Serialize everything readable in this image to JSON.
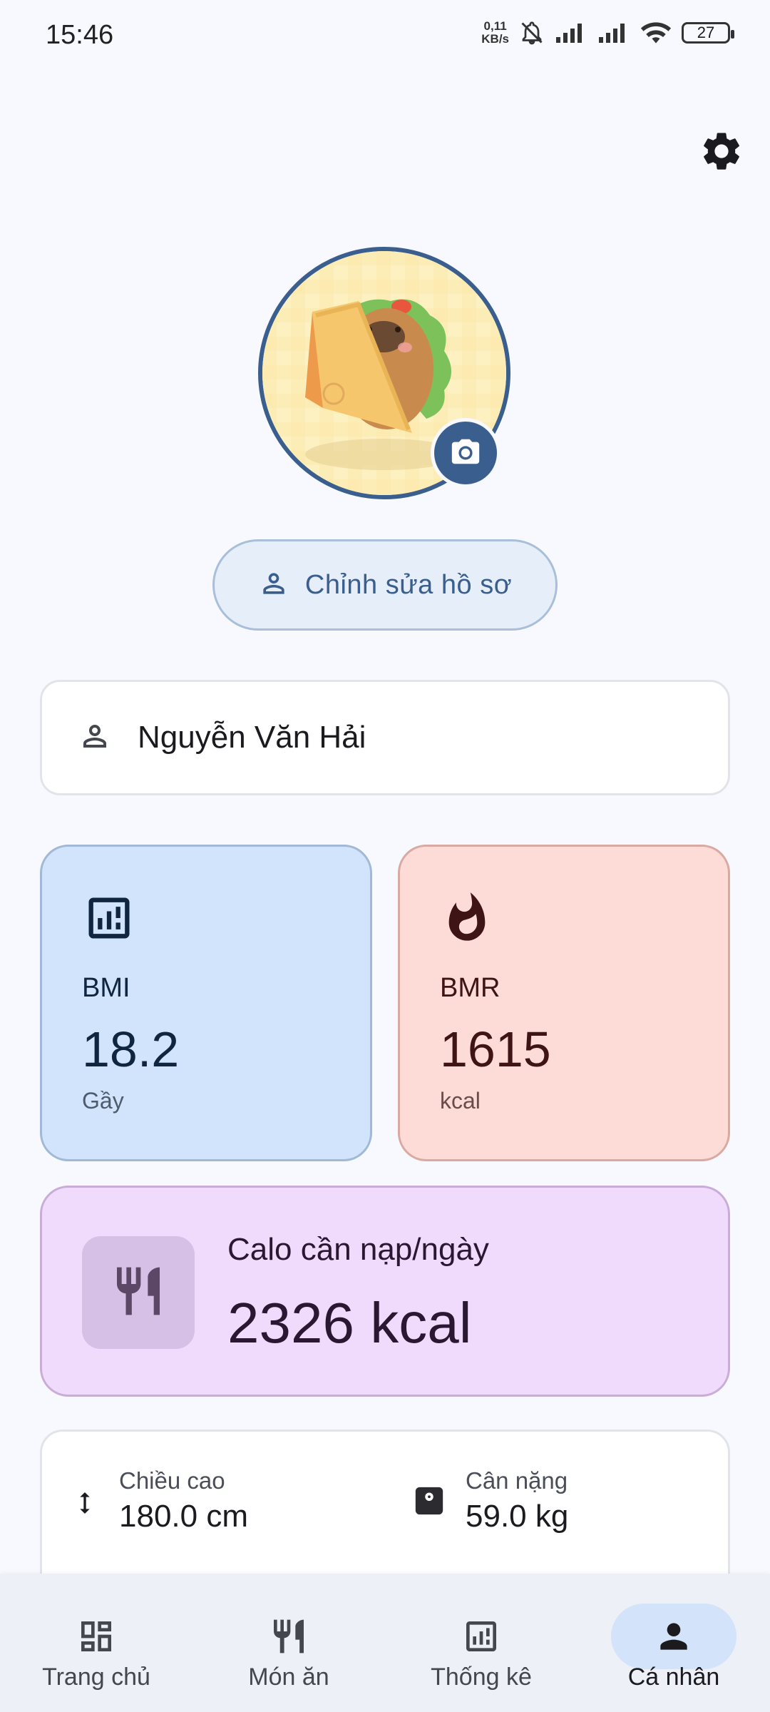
{
  "status_bar": {
    "time": "15:46",
    "net_speed_value": "0,11",
    "net_speed_unit": "KB/s",
    "battery": "27"
  },
  "profile": {
    "edit_label": "Chỉnh sửa hồ sơ",
    "name": "Nguyễn Văn Hải"
  },
  "bmi": {
    "label": "BMI",
    "value": "18.2",
    "status": "Gầy"
  },
  "bmr": {
    "label": "BMR",
    "value": "1615",
    "unit": "kcal"
  },
  "calories": {
    "label": "Calo cần nạp/ngày",
    "value": "2326 kcal"
  },
  "measurements": {
    "height_label": "Chiều cao",
    "height_value": "180.0 cm",
    "weight_label": "Cân nặng",
    "weight_value": "59.0 kg"
  },
  "nav": {
    "items": [
      {
        "label": "Trang chủ",
        "icon": "dashboard-icon"
      },
      {
        "label": "Món ăn",
        "icon": "restaurant-icon"
      },
      {
        "label": "Thống kê",
        "icon": "stats-icon"
      },
      {
        "label": "Cá nhân",
        "icon": "person-icon",
        "active": true
      }
    ]
  },
  "colors": {
    "primary": "#3a5f8f",
    "bmi_card": "#d2e4fb",
    "bmr_card": "#fddbd6",
    "calorie_card": "#f1dbfc"
  }
}
